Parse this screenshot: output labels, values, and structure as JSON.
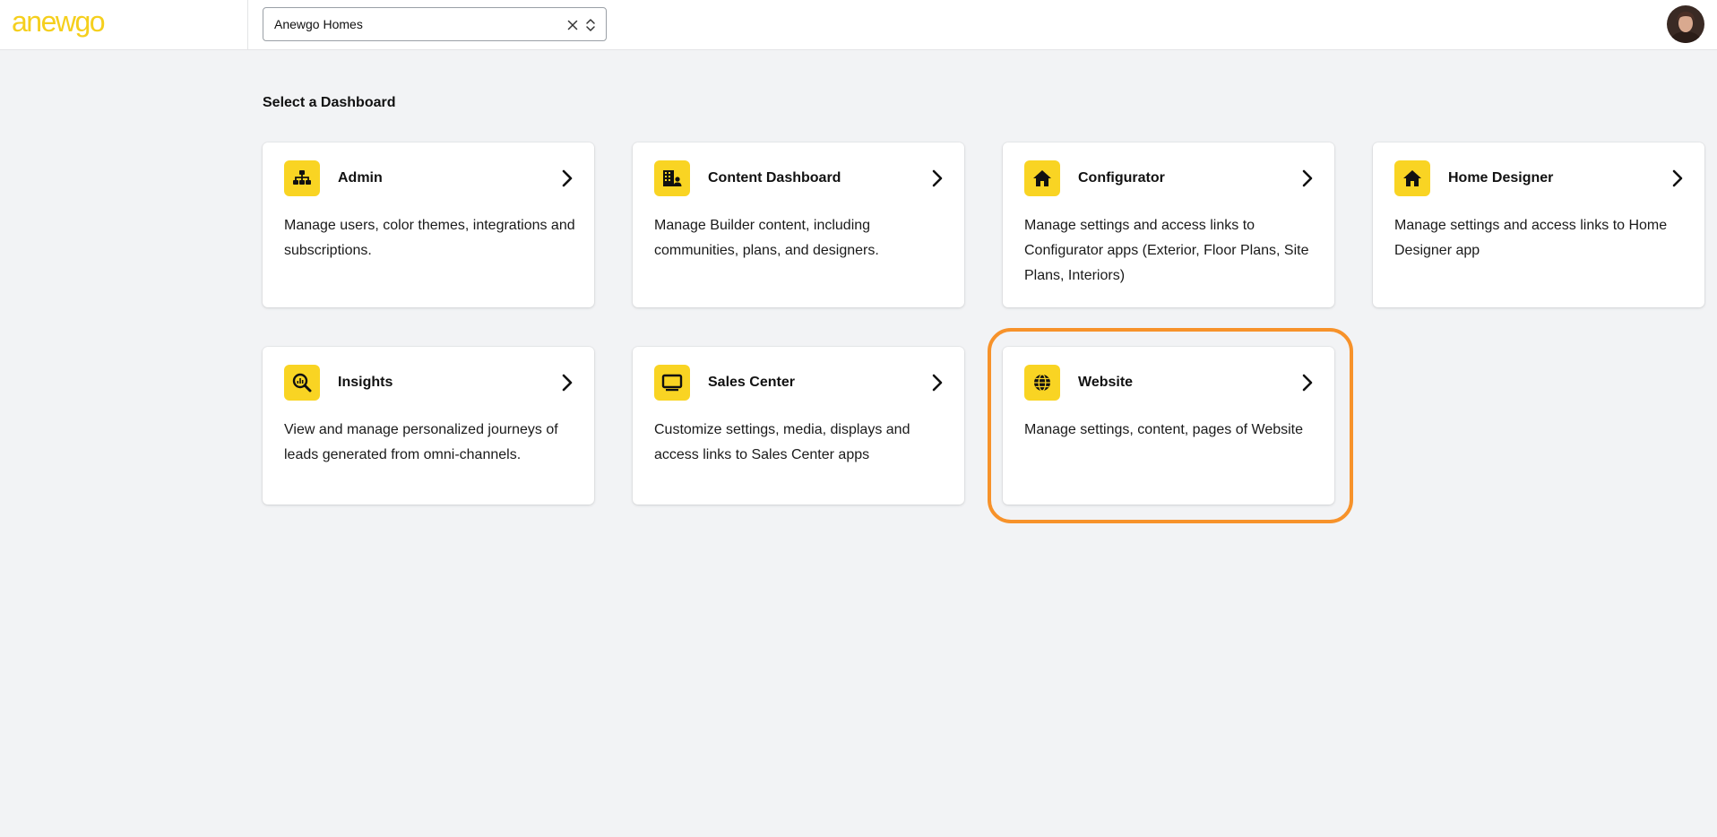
{
  "brand": {
    "logo_text": "anewgo"
  },
  "header": {
    "builder_select": {
      "value": "Anewgo Homes"
    }
  },
  "page": {
    "heading": "Select a Dashboard"
  },
  "cards": [
    {
      "title": "Admin",
      "icon": "sitemap-icon",
      "description": "Manage users, color themes, integrations and subscriptions."
    },
    {
      "title": "Content Dashboard",
      "icon": "building-user-icon",
      "description": "Manage Builder content, including communities, plans, and designers."
    },
    {
      "title": "Configurator",
      "icon": "home-icon",
      "description": "Manage settings and access links to Configurator apps (Exterior, Floor Plans, Site Plans, Interiors)"
    },
    {
      "title": "Home Designer",
      "icon": "home-icon",
      "description": "Manage settings and access links to Home Designer app"
    },
    {
      "title": "Insights",
      "icon": "chart-search-icon",
      "description": "View and manage personalized journeys of leads generated from omni-channels."
    },
    {
      "title": "Sales Center",
      "icon": "monitor-icon",
      "description": "Customize settings, media, displays and access links to Sales Center apps"
    },
    {
      "title": "Website",
      "icon": "globe-icon",
      "description": "Manage settings, content, pages of Website"
    }
  ],
  "colors": {
    "accent": "#f9d423",
    "highlight": "#f7922a",
    "background": "#f2f3f5"
  }
}
